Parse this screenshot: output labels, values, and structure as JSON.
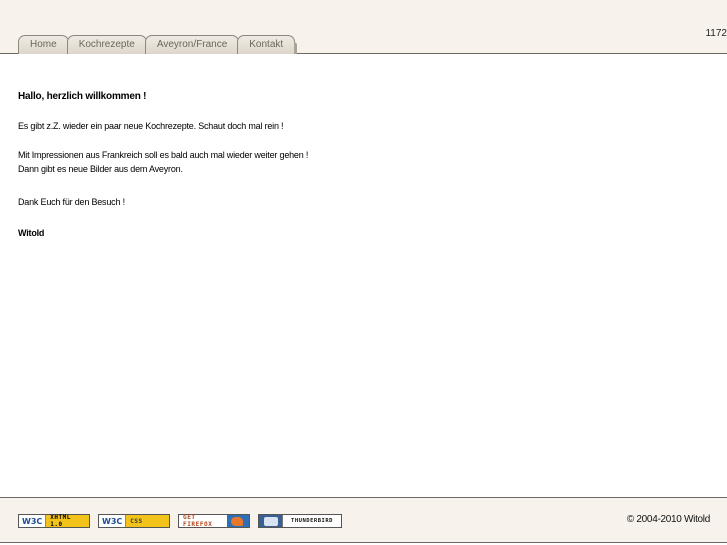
{
  "header": {
    "counter": "1172",
    "tabs": [
      "Home",
      "Kochrezepte",
      "Aveyron/France",
      "Kontakt"
    ]
  },
  "main": {
    "greeting": "Hallo, herzlich willkommen !",
    "para1": "Es gibt z.Z. wieder ein paar neue Kochrezepte. Schaut doch mal rein !",
    "para2_line1": "Mit Impressionen aus Frankreich soll es bald auch mal wieder weiter gehen !",
    "para2_line2": "Dann gibt es neue Bilder aus dem Aveyron.",
    "para3": "Dank Euch für den Besuch !",
    "signature": "Witold"
  },
  "footer": {
    "badges": {
      "xhtml_w3c": "W3C",
      "xhtml_label": "XHTML 1.0",
      "css_w3c": "W3C",
      "css_label": "CSS",
      "firefox_label": "GET FIREFOX",
      "thunderbird_label": "THUNDERBIRD"
    },
    "copyright": "© 2004-2010 Witold"
  },
  "colors": {
    "header_bg": "#f7f3ec",
    "tab_text": "#6a6660",
    "badge_yellow": "#f2c31a"
  }
}
